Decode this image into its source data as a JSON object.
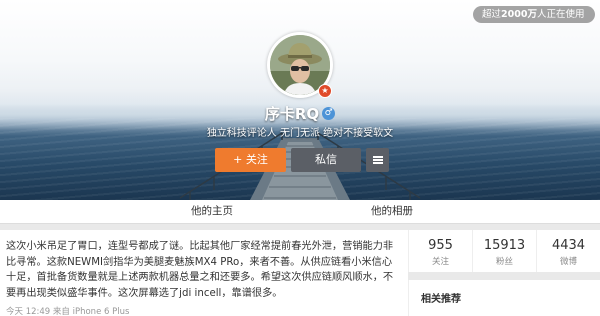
{
  "online_pill": {
    "prefix": "超过",
    "count": "2000万",
    "suffix": "人正在使用"
  },
  "profile": {
    "name": "序卡RQ",
    "bio": "独立科技评论人 无门无派 绝对不接受软文"
  },
  "actions": {
    "follow_label": "+ 关注",
    "message_label": "私信",
    "more_icon": "menu-icon"
  },
  "nav": {
    "tabs": [
      {
        "label": "他的主页"
      },
      {
        "label": "他的相册"
      }
    ]
  },
  "post": {
    "text": "这次小米吊足了胃口，连型号都成了谜。比起其他厂家经常提前春光外泄，营销能力非比寻常。这款NEWMI剑指华为美腿麦魅族MX4 PRo，来者不善。从供应链看小米信心十足，首批备货数量就是上述两款机器总量之和还要多。希望这次供应链顺风顺水，不要再出现类似盛华事件。这次屏幕选了jdi incell，靠谱很多。",
    "meta": "今天 12:49 来自 iPhone 6 Plus"
  },
  "stats": [
    {
      "num": "955",
      "label": "关注"
    },
    {
      "num": "15913",
      "label": "粉丝"
    },
    {
      "num": "4434",
      "label": "微博"
    }
  ],
  "related": {
    "title": "相关推荐"
  },
  "colors": {
    "follow_orange": "#ef7b2e",
    "button_gray": "#5b5f66",
    "verified_red": "#e04b2a",
    "gender_blue": "#4c93d7"
  }
}
